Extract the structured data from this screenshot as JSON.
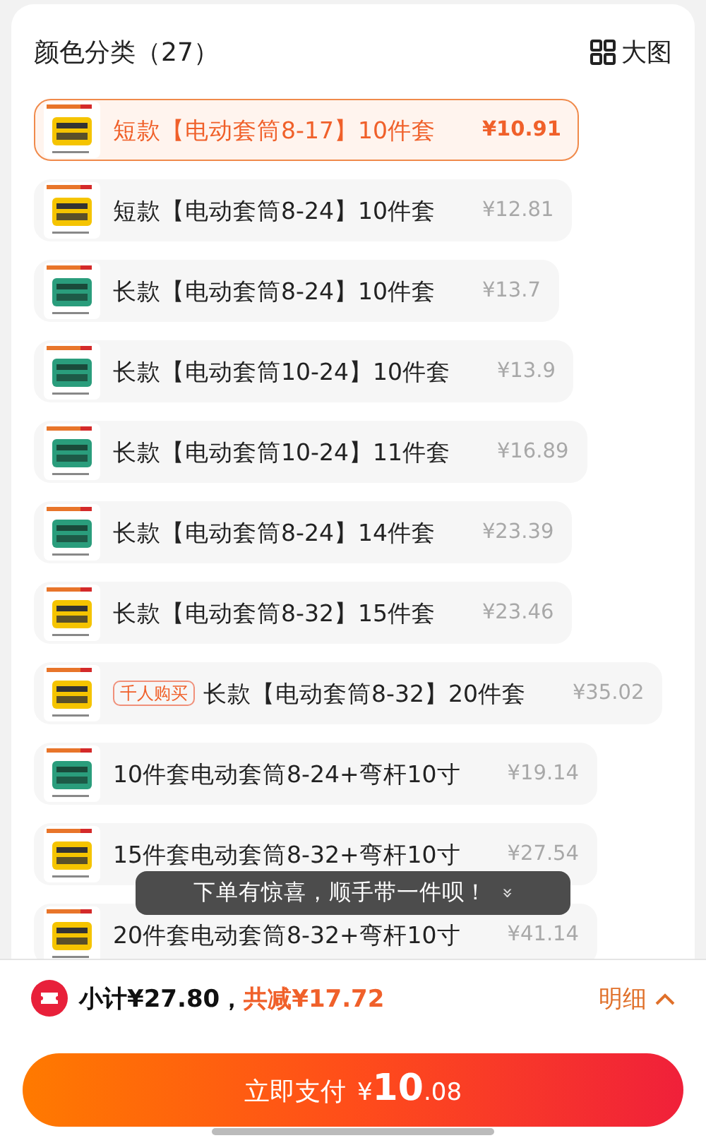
{
  "header": {
    "title": "颜色分类（27）",
    "view_toggle": "大图"
  },
  "options": [
    {
      "label": "短款【电动套筒8-17】10件套",
      "price": "¥10.91",
      "selected": true
    },
    {
      "label": "短款【电动套筒8-24】10件套",
      "price": "¥12.81",
      "selected": false
    },
    {
      "label": "长款【电动套筒8-24】10件套",
      "price": "¥13.7",
      "selected": false
    },
    {
      "label": "长款【电动套筒10-24】10件套",
      "price": "¥13.9",
      "selected": false
    },
    {
      "label": "长款【电动套筒10-24】11件套",
      "price": "¥16.89",
      "selected": false
    },
    {
      "label": "长款【电动套筒8-24】14件套",
      "price": "¥23.39",
      "selected": false
    },
    {
      "label": "长款【电动套筒8-32】15件套",
      "price": "¥23.46",
      "selected": false
    },
    {
      "tag": "千人购买",
      "label": "长款【电动套筒8-32】20件套",
      "price": "¥35.02",
      "selected": false
    },
    {
      "label": "10件套电动套筒8-24+弯杆10寸",
      "price": "¥19.14",
      "selected": false
    },
    {
      "label": "15件套电动套筒8-32+弯杆10寸",
      "price": "¥27.54",
      "selected": false
    },
    {
      "label": "20件套电动套筒8-32+弯杆10寸",
      "price": "¥41.14",
      "selected": false
    }
  ],
  "toast": {
    "text": "下单有惊喜，顺手带一件呗！",
    "icon": "»"
  },
  "summary": {
    "subtotal": "小计¥27.80，",
    "discount": "共减¥17.72",
    "details": "明细"
  },
  "pay_button": {
    "label": "立即支付",
    "currency": "¥",
    "amount_integer": "10",
    "amount_decimal": ".08"
  }
}
